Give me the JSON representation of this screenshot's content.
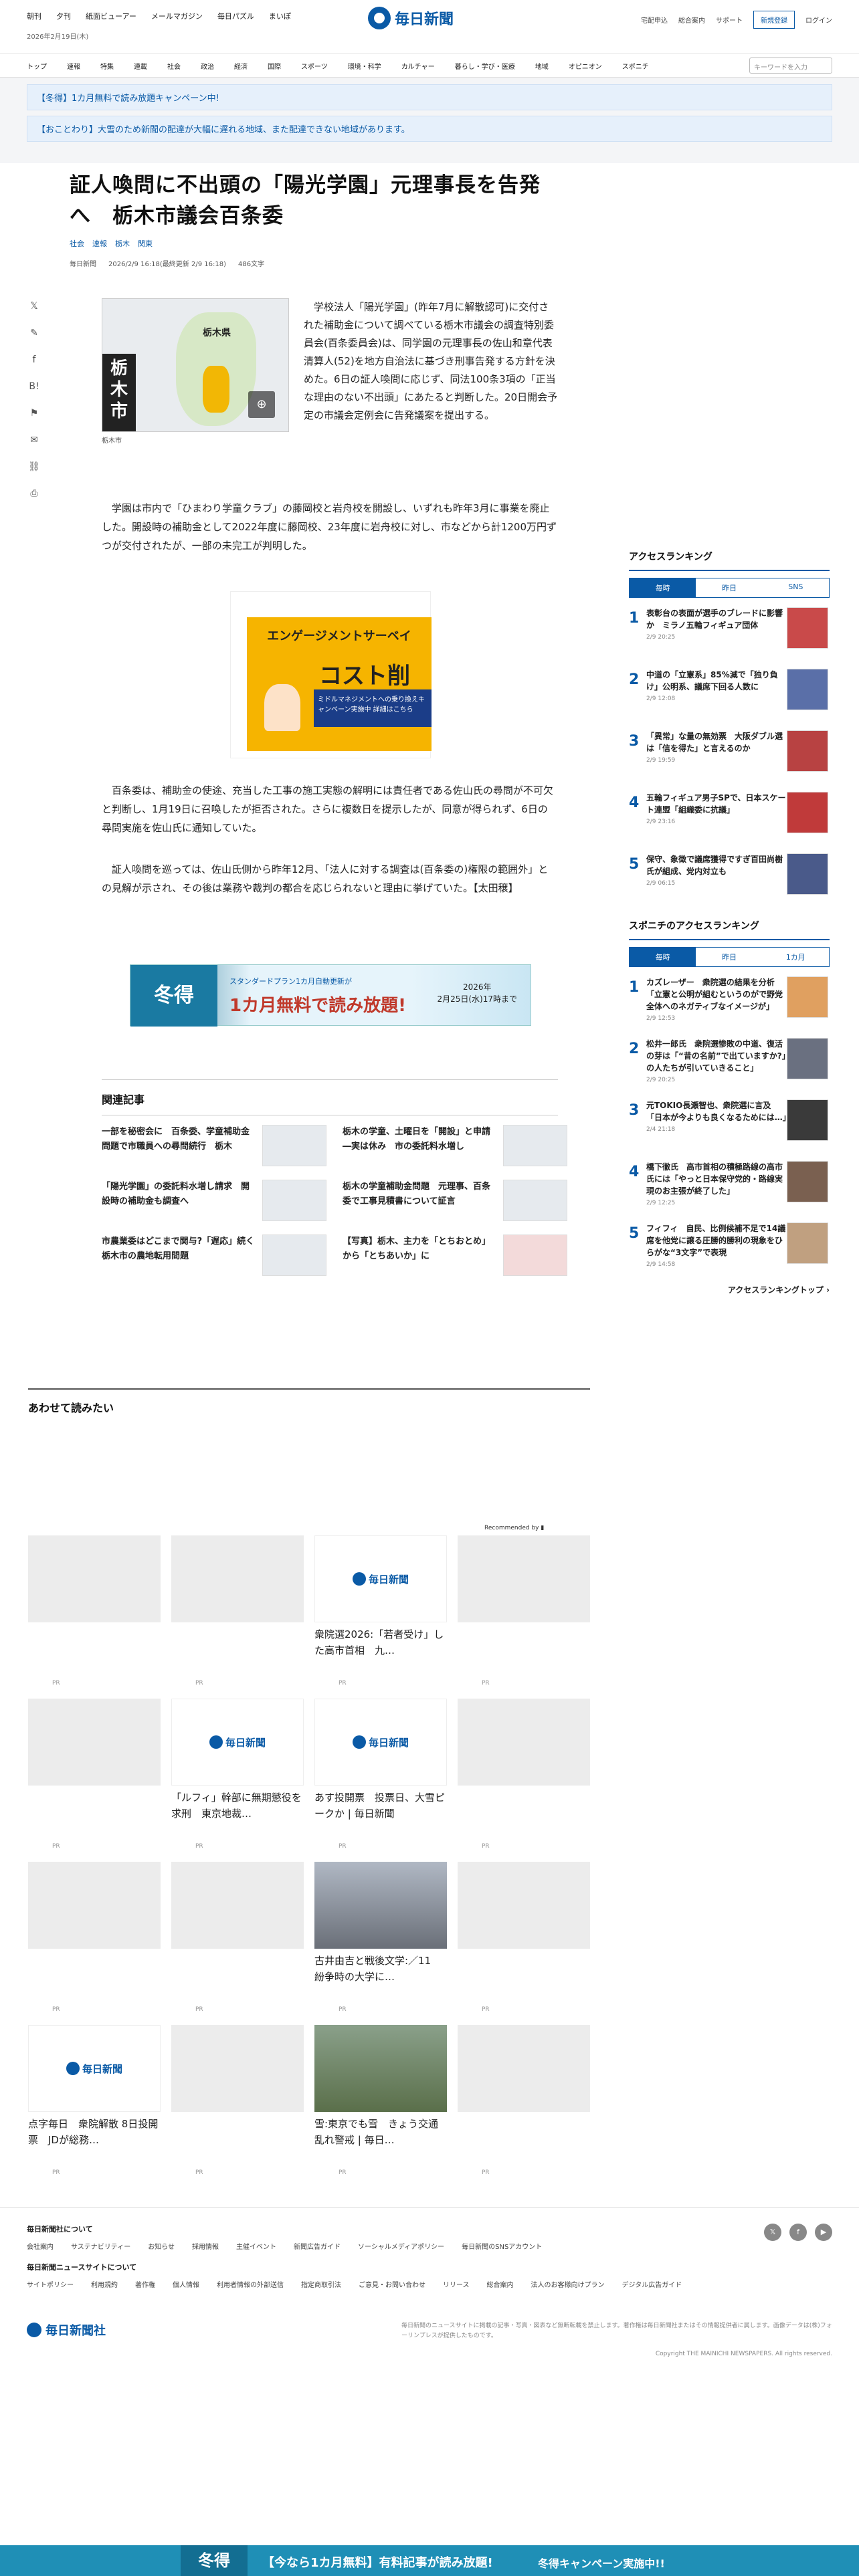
{
  "header": {
    "top_links": [
      "朝刊",
      "夕刊",
      "紙面ビューアー",
      "メールマガジン",
      "毎日パズル",
      "まいぽ"
    ],
    "date": "2026年2月19日(木)",
    "logo": "毎日新聞",
    "right_links": [
      "宅配申込",
      "総合案内",
      "サポート"
    ],
    "register": "新規登録",
    "login": "ログイン"
  },
  "nav": {
    "items": [
      "トップ",
      "速報",
      "特集",
      "連載",
      "社会",
      "政治",
      "経済",
      "国際",
      "スポーツ",
      "環境・科学",
      "カルチャー",
      "暮らし・学び・医療",
      "地域",
      "オピニオン",
      "スポニチ"
    ],
    "search_placeholder": "キーワードを入力"
  },
  "notices": [
    "【冬得】1カ月無料で読み放題キャンペーン中!",
    "【おことわり】大雪のため新聞の配達が大幅に遅れる地域、また配達できない地域があります。"
  ],
  "article": {
    "headline": "証人喚問に不出頭の「陽光学園」元理事長を告発へ　栃木市議会百条委",
    "tags": [
      "社会",
      "速報",
      "栃木",
      "関東"
    ],
    "source": "毎日新聞",
    "datetime": "2026/2/9 16:18(最終更新 2/9 16:18)",
    "chars": "486文字",
    "map_label": "栃木市",
    "map_pref": "栃木県",
    "caption": "栃木市",
    "lead": "学校法人「陽光学園」(昨年7月に解散認可)に交付された補助金について調べている栃木市議会の調査特別委員会(百条委員会)は、同学園の元理事長の佐山和章代表清算人(52)を地方自治法に基づき刑事告発する方針を決めた。6日の証人喚問に応じず、同法100条3項の「正当な理由のない不出頭」にあたると判断した。20日開会予定の市議会定例会に告発議案を提出する。",
    "p1": "学園は市内で「ひまわり学童クラブ」の藤岡校と岩舟校を開設し、いずれも昨年3月に事業を廃止した。開設時の補助金として2022年度に藤岡校、23年度に岩舟校に対し、市などから計1200万円ずつが交付されたが、一部の未完工が判明した。",
    "p2": "百条委は、補助金の使途、充当した工事の施工実態の解明には責任者である佐山氏の尋問が不可欠と判断し、1月19日に召喚したが拒否された。さらに複数日を提示したが、同意が得られず、6日の尋問実施を佐山氏に通知していた。",
    "p3": "証人喚問を巡っては、佐山氏側から昨年12月、「法人に対する調査は(百条委の)権限の範囲外」との見解が示され、その後は業務や裁判の都合を応じられないと理由に挙げていた。【太田穣】"
  },
  "ad": {
    "title": "エンゲージメントサーベイ",
    "big": "コスト削減",
    "box": "ミドルマネジメントへの乗り換えキャンペーン実施中 詳細はこちら"
  },
  "banner": {
    "left": "冬得",
    "top": "スタンダードプラン1カ月自動更新が",
    "big": "1カ月無料で読み放題!",
    "right1": "2026年",
    "right2": "2月25日(水)17時まで"
  },
  "related": {
    "title": "関連記事",
    "items": [
      "一部を秘密会に　百条委、学童補助金問題で市職員への尋問続行　栃木",
      "栃木の学童、土曜日を「開設」と申請―実は休み　市の委託料水増し",
      "「陽光学園」の委託料水増し請求　開設時の補助金も調査へ",
      "栃木の学童補助金問題　元理事、百条委で工事見積書について証言",
      "市農業委はどこまで関与?「遅応」続く栃木市の農地転用問題",
      "【写真】栃木、主力を「とちおとめ」から「とちあいか」に"
    ]
  },
  "ranking": {
    "title": "アクセスランキング",
    "tabs": [
      "毎時",
      "昨日",
      "SNS"
    ],
    "items": [
      {
        "n": "1",
        "t": "表彰台の表面が選手のブレードに影響か　ミラノ五輪フィギュア団体",
        "d": "2/9 20:25"
      },
      {
        "n": "2",
        "t": "中道の「立憲系」85%減で「独り負け」公明系、議席下回る人数に",
        "d": "2/9 12:08"
      },
      {
        "n": "3",
        "t": "「異常」な量の無効票　大阪ダブル選は「信を得た」と言えるのか",
        "d": "2/9 19:59"
      },
      {
        "n": "4",
        "t": "五輪フィギュア男子SPで、日本スケート連盟「組織委に抗議」",
        "d": "2/9 23:16"
      },
      {
        "n": "5",
        "t": "保守、象徴で議席獲得ですぎ百田尚樹氏が組成、党内対立も",
        "d": "2/9 06:15"
      }
    ]
  },
  "sponichi": {
    "title": "スポニチのアクセスランキング",
    "tabs": [
      "毎時",
      "昨日",
      "1カ月"
    ],
    "items": [
      {
        "n": "1",
        "t": "カズレーザー　衆院選の結果を分析「立憲と公明が組むというのがで野党全体へのネガティブなイメージが」",
        "d": "2/9 12:53"
      },
      {
        "n": "2",
        "t": "松井一郎氏　衆院選惨敗の中道、復活の芽は「“昔の名前”で出ていますか?」の人たちが引いていきること」",
        "d": "2/9 20:25"
      },
      {
        "n": "3",
        "t": "元TOKIO長瀬智也、衆院選に言及「日本が今よりも良くなるためには…」",
        "d": "2/4 21:18"
      },
      {
        "n": "4",
        "t": "橋下徹氏　高市首相の積極路線の高市氏には「やっと日本保守党的・路線実現のお主張が終了した」",
        "d": "2/9 12:25"
      },
      {
        "n": "5",
        "t": "フィフィ　自民、比例候補不足で14議席を他党に譲る圧勝的勝利の現象をひらがな“3文字”で表現",
        "d": "2/9 14:58"
      }
    ],
    "more": "アクセスランキングトップ"
  },
  "recommend": {
    "title": "あわせて読みたい",
    "by": "Recommended by",
    "pr": "PR",
    "cards": [
      "",
      "",
      "衆院選2026:「若者受け」した高市首相　九…",
      "",
      "",
      "「ルフィ」幹部に無期懲役を求刑　東京地裁…",
      "あす投開票　投票日、大雪ピークか | 毎日新聞",
      "",
      "",
      "",
      "古井由吉と戦後文学:／11　紛争時の大学に…",
      "",
      "点字毎日　衆院解散 8日投開票　JDが総務…",
      "",
      "雪:東京でも雪　きょう交通乱れ警戒 | 毎日…",
      ""
    ]
  },
  "footer": {
    "about_title": "毎日新聞社について",
    "about_links": [
      "会社案内",
      "サステナビリティー",
      "お知らせ",
      "採用情報",
      "主催イベント",
      "新聞広告ガイド",
      "ソーシャルメディアポリシー",
      "毎日新聞のSNSアカウント"
    ],
    "site_title": "毎日新聞ニュースサイトについて",
    "site_links": [
      "サイトポリシー",
      "利用規約",
      "著作権",
      "個人情報",
      "利用者情報の外部送信",
      "指定商取引法",
      "ご意見・お問い合わせ",
      "リリース",
      "総合案内",
      "法人のお客様向けプラン",
      "デジタル広告ガイド"
    ],
    "logo": "毎日新聞社",
    "note": "毎日新聞のニュースサイトに掲載の記事・写真・図表など無断転載を禁止します。著作権は毎日新聞社またはその情報提供者に属します。画像データは(株)フォーリンプレスが提供したものです。",
    "copyright": "Copyright THE MAINICHI NEWSPAPERS. All rights reserved."
  },
  "bottom": {
    "left": "冬得",
    "msg": "【今なら1カ月無料】有料記事が読み放題!",
    "cta": "冬得キャンペーン実施中!!"
  }
}
